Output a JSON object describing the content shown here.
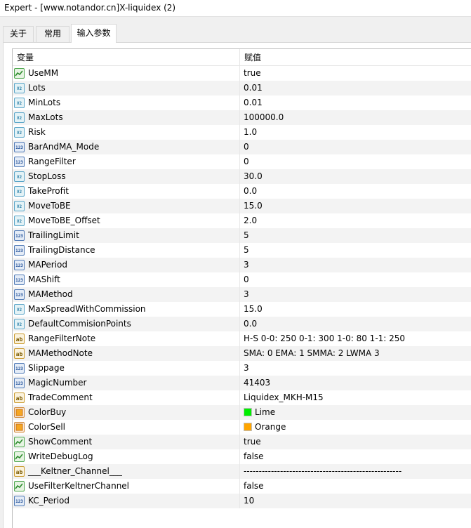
{
  "window": {
    "title": "Expert - [www.notandor.cn]X-liquidex (2)"
  },
  "tabs": [
    {
      "label": "关于",
      "active": false
    },
    {
      "label": "常用",
      "active": false
    },
    {
      "label": "输入参数",
      "active": true
    }
  ],
  "grid": {
    "headers": {
      "variable": "变量",
      "value": "赋值"
    },
    "rows": [
      {
        "name": "UseMM",
        "type": "bool",
        "value": "true"
      },
      {
        "name": "Lots",
        "type": "double",
        "value": "0.01"
      },
      {
        "name": "MinLots",
        "type": "double",
        "value": "0.01"
      },
      {
        "name": "MaxLots",
        "type": "double",
        "value": "100000.0"
      },
      {
        "name": "Risk",
        "type": "double",
        "value": "1.0"
      },
      {
        "name": "BarAndMA_Mode",
        "type": "int",
        "value": "0"
      },
      {
        "name": "RangeFilter",
        "type": "int",
        "value": "0"
      },
      {
        "name": "StopLoss",
        "type": "double",
        "value": "30.0"
      },
      {
        "name": "TakeProfit",
        "type": "double",
        "value": "0.0"
      },
      {
        "name": "MoveToBE",
        "type": "double",
        "value": "15.0"
      },
      {
        "name": "MoveToBE_Offset",
        "type": "double",
        "value": "2.0"
      },
      {
        "name": "TrailingLimit",
        "type": "int",
        "value": "5"
      },
      {
        "name": "TrailingDistance",
        "type": "int",
        "value": "5"
      },
      {
        "name": "MAPeriod",
        "type": "int",
        "value": "3"
      },
      {
        "name": "MAShift",
        "type": "int",
        "value": "0"
      },
      {
        "name": "MAMethod",
        "type": "int",
        "value": "3"
      },
      {
        "name": "MaxSpreadWithCommission",
        "type": "double",
        "value": "15.0"
      },
      {
        "name": "DefaultCommisionPoints",
        "type": "double",
        "value": "0.0"
      },
      {
        "name": "RangeFilterNote",
        "type": "string",
        "value": "H-S 0-0: 250 0-1: 300 1-0: 80 1-1: 250"
      },
      {
        "name": "MAMethodNote",
        "type": "string",
        "value": "SMA: 0 EMA: 1 SMMA: 2 LWMA 3"
      },
      {
        "name": "Slippage",
        "type": "int",
        "value": "3"
      },
      {
        "name": "MagicNumber",
        "type": "int",
        "value": "41403"
      },
      {
        "name": "TradeComment",
        "type": "string",
        "value": "Liquidex_MKH-M15"
      },
      {
        "name": "ColorBuy",
        "type": "color",
        "value": "Lime",
        "swatch": "#00ee00"
      },
      {
        "name": "ColorSell",
        "type": "color",
        "value": "Orange",
        "swatch": "#ffa500"
      },
      {
        "name": "ShowComment",
        "type": "bool",
        "value": "true"
      },
      {
        "name": "WriteDebugLog",
        "type": "bool",
        "value": "false"
      },
      {
        "name": "___Keltner_Channel___",
        "type": "string",
        "value": "----------------------------------------------------"
      },
      {
        "name": "UseFilterKeltnerChannel",
        "type": "bool",
        "value": "false"
      },
      {
        "name": "KC_Period",
        "type": "int",
        "value": "10"
      }
    ]
  },
  "icons": {
    "bool": "bool-param-icon",
    "double": "double-param-icon",
    "int": "int-param-icon",
    "string": "string-param-icon",
    "color": "color-param-icon"
  }
}
